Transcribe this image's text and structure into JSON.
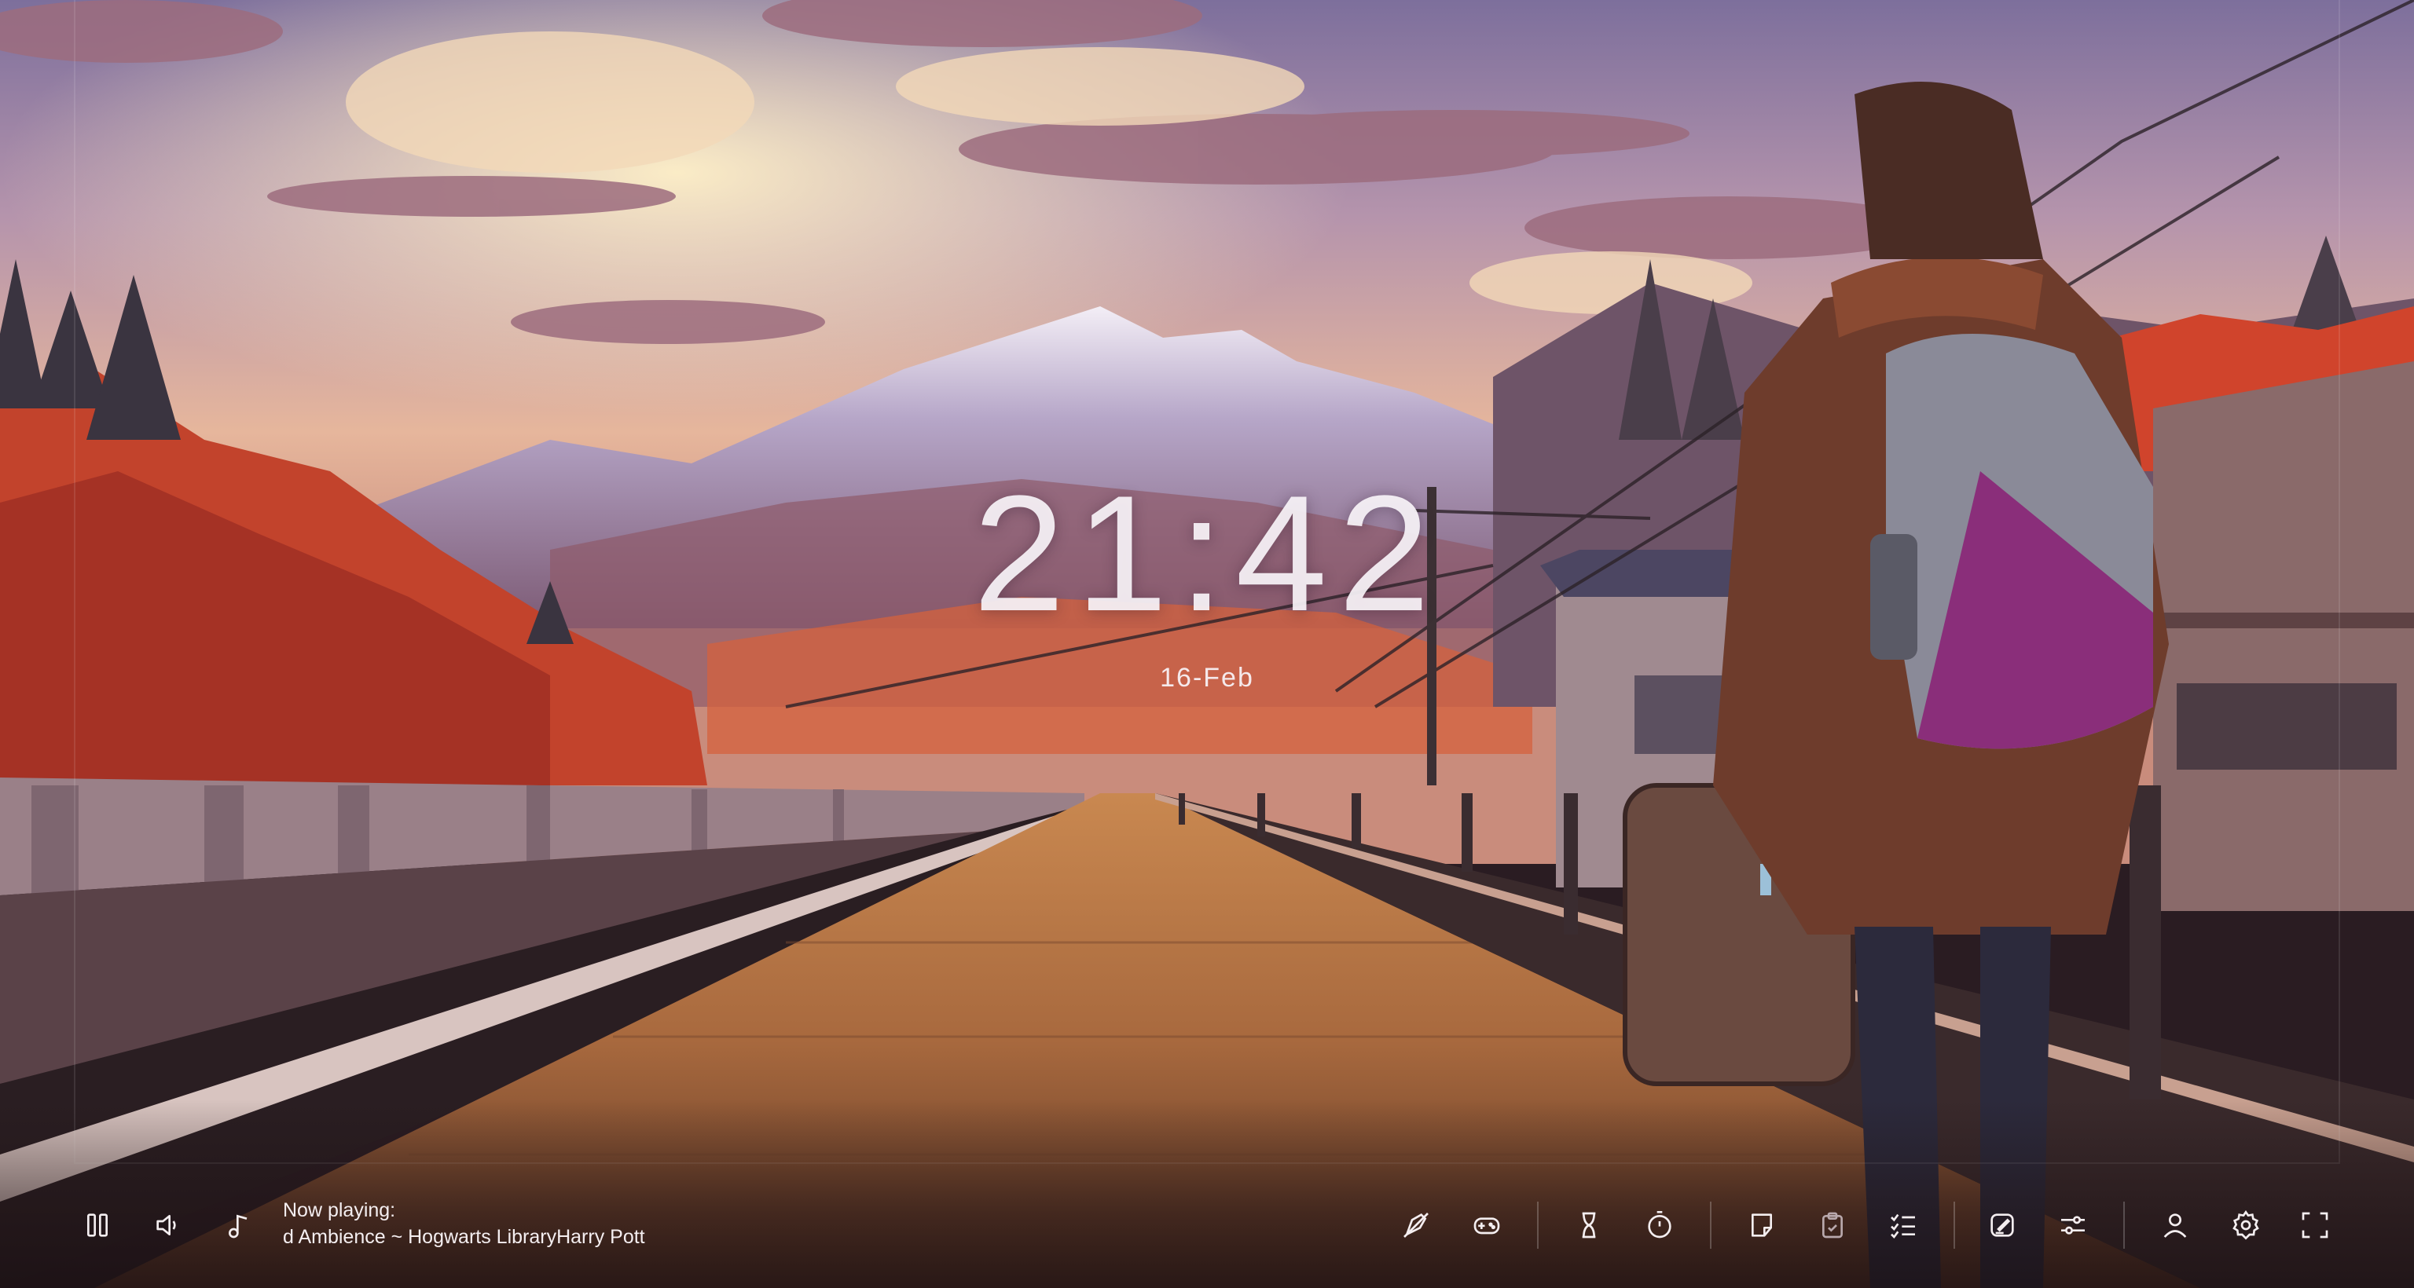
{
  "clock": {
    "time": "21:42",
    "date": "16-Feb"
  },
  "player": {
    "now_playing_label": "Now playing:",
    "track_title": "d Ambience ~ Hogwarts LibraryHarry Pott"
  },
  "toolbar": {
    "left_icons": [
      "pause-icon",
      "volume-icon",
      "music-note-icon"
    ],
    "right_icons": [
      "focus-off-icon",
      "gamepad-icon",
      "hourglass-icon",
      "stopwatch-icon",
      "sticky-note-icon",
      "clipboard-icon",
      "checklist-icon",
      "edit-note-icon",
      "sliders-icon",
      "user-icon",
      "gear-icon",
      "fullscreen-icon"
    ]
  },
  "colors": {
    "icon": "#f4eef0",
    "clock_text": "#f8f4f8",
    "sky_top": "#8a7aa6",
    "sky_glow": "#f6d8a8",
    "foliage": "#d2452c"
  }
}
